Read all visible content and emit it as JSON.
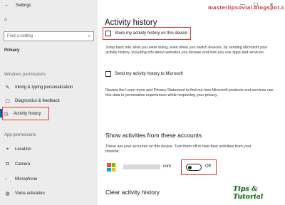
{
  "window": {
    "title": "Settings"
  },
  "sidebar": {
    "home": "",
    "search_placeholder": "Find a setting",
    "section": "Privacy",
    "windows_permissions_label": "Windows permissions",
    "windows_items": [
      {
        "label": "Inking & typing personalization",
        "icon": "pen-icon"
      },
      {
        "label": "Diagnostics & feedback",
        "icon": "feedback-icon"
      },
      {
        "label": "Activity history",
        "icon": "history-icon"
      }
    ],
    "app_permissions_label": "App permissions",
    "app_items": [
      {
        "label": "Location",
        "icon": "location-icon"
      },
      {
        "label": "Camera",
        "icon": "camera-icon"
      },
      {
        "label": "Microphone",
        "icon": "microphone-icon"
      },
      {
        "label": "Voice activation",
        "icon": "voice-icon"
      }
    ]
  },
  "main": {
    "title": "Activity history",
    "store_checkbox_label": "Store my activity history on this device",
    "store_checked": false,
    "description": "Jump back into what you were doing, even when you switch devices, by sending Microsoft your activity history, including info about websites you browse and how you use apps and services.",
    "send_checkbox_label": "Send my activity history to Microsoft",
    "send_checked": false,
    "privacy_text": "Review the Learn more and Privacy Statement to find out how Microsoft products and services use this data to personalize experiences while respecting your privacy.",
    "accounts_heading": "Show activities from these accounts",
    "accounts_desc": "These are your accounts on this device. Turn them off to hide their activities from your timeline.",
    "account_suffix": ".com",
    "toggle_state": "Off",
    "clear_heading": "Clear activity history"
  },
  "watermark": "masterlipsovial.blogspot.com",
  "overlay_label": "Tips & Tutorial",
  "colors": {
    "accent": "#0063b1",
    "highlight": "#e53935",
    "overlay_text": "#1b6e1b"
  }
}
